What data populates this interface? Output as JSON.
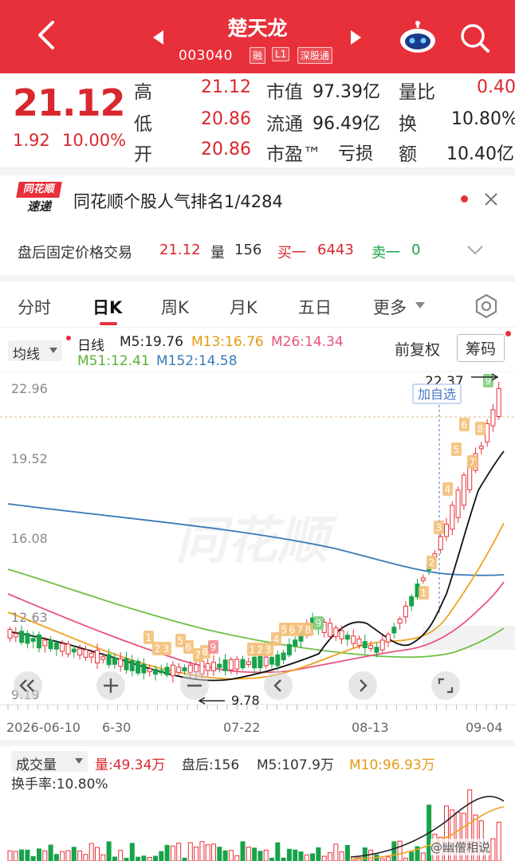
{
  "header": {
    "title": "楚天龙",
    "code": "003040",
    "tags": [
      "融",
      "L1",
      "深股通"
    ]
  },
  "quote": {
    "price": "21.12",
    "change": "1.92",
    "change_pct": "10.00%",
    "high_label": "高",
    "high": "21.12",
    "low_label": "低",
    "low": "20.86",
    "open_label": "开",
    "open": "20.86",
    "mktcap_label": "市值",
    "mktcap": "97.39亿",
    "float_label": "流通",
    "float": "96.49亿",
    "pe_label": "市盈™",
    "pe": "亏损",
    "volratio_label": "量比",
    "volratio": "0.40",
    "turnover_label": "换",
    "turnover": "10.80%",
    "amount_label": "额",
    "amount": "10.40亿"
  },
  "banner": {
    "logo_top": "同花顺",
    "logo_bottom": "速递",
    "text": "同花顺个股人气排名1/4284"
  },
  "afterhours": {
    "label": "盘后固定价格交易",
    "price": "21.12",
    "vol_label": "量",
    "vol": "156",
    "buy_label": "买一",
    "buy": "6443",
    "sell_label": "卖一",
    "sell": "0"
  },
  "tabs": [
    "分时",
    "日K",
    "周K",
    "月K",
    "五日",
    "更多"
  ],
  "indicators": {
    "ma_select": "均线",
    "period": "日线",
    "m5": "M5:19.76",
    "m13": "M13:16.76",
    "m26": "M26:14.34",
    "m51": "M51:12.41",
    "m152": "M152:14.58",
    "adjust": "前复权",
    "chips": "筹码"
  },
  "chart": {
    "y_ticks": [
      "22.96",
      "19.52",
      "16.08",
      "12.63",
      "9.19"
    ],
    "x_ticks": [
      "2026-06-10",
      "6-30",
      "07-22",
      "08-13",
      "09-04"
    ],
    "high_marker": "22.37",
    "low_marker": "9.78",
    "add_watch": "加自选",
    "watermark": "同花顺",
    "colors": {
      "up": "#e8303a",
      "down": "#17a34a",
      "m5": "#111111",
      "m13": "#f0a21d",
      "m26": "#e8557a",
      "m51": "#6dc144",
      "m152": "#3a7ab8"
    }
  },
  "volume": {
    "label": "成交量",
    "vol": "量:49.34万",
    "after": "盘后:156",
    "m5": "M5:107.9万",
    "m10": "M10:96.93万",
    "turnover": "换手率:10.80%"
  },
  "footer": {
    "watermark": "@幽僧相说"
  }
}
